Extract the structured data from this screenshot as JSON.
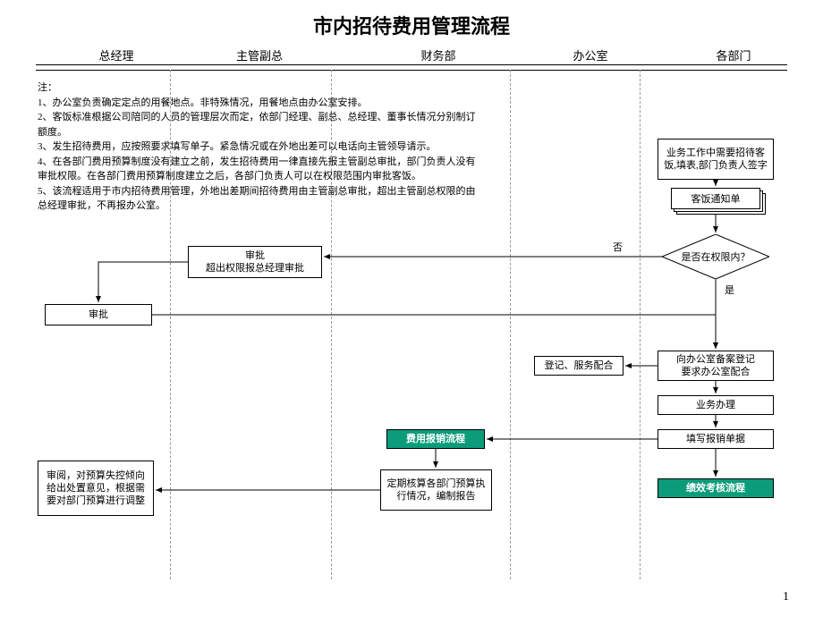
{
  "title": "市内招待费用管理流程",
  "lanes": {
    "gm": "总经理",
    "vp": "主管副总",
    "finance": "财务部",
    "office": "办公室",
    "dept": "各部门"
  },
  "notes": {
    "heading": "注：",
    "n1": "1、办公室负责确定定点的用餐地点。非特殊情况，用餐地点由办公室安排。",
    "n2": "2、客饭标准根据公司陪同的人员的管理层次而定，依部门经理、副总、总经理、董事长情况分别制订额度。",
    "n3": "3、发生招待费用，应按照要求填写单子。紧急情况或在外地出差可以电话向主管领导请示。",
    "n4": "4、在各部门费用预算制度没有建立之前，发生招待费用一律直接先报主管副总审批，部门负责人没有审批权限。在各部门费用预算制度建立之后，各部门负责人可以在权限范围内审批客饭。",
    "n5": "5、该流程适用于市内招待费用管理，外地出差期间招待费用由主管副总审批，超出主管副总权限的由总经理审批，不再报办公室。"
  },
  "nodes": {
    "start": "业务工作中需要招待客饭,填表,部门负责人签字",
    "doc": "客饭通知单",
    "decision": "是否在权限内？",
    "no": "否",
    "yes": "是",
    "vp_approve": "审批\n超出权限报总经理审批",
    "gm_approve": "审批",
    "register_office": "登记、服务配合",
    "file_office": "向办公室备案登记\n要求办公室配合",
    "handle": "业务办理",
    "fill_reimb": "填写报销单据",
    "reimb_sub": "费用报销流程",
    "perf_sub": "绩效考核流程",
    "periodic_report": "定期核算各部门预算执行情况，编制报告",
    "gm_review": "审阅，对预算失控倾向给出处置意见，根据需要对部门预算进行调整"
  },
  "page": "1"
}
